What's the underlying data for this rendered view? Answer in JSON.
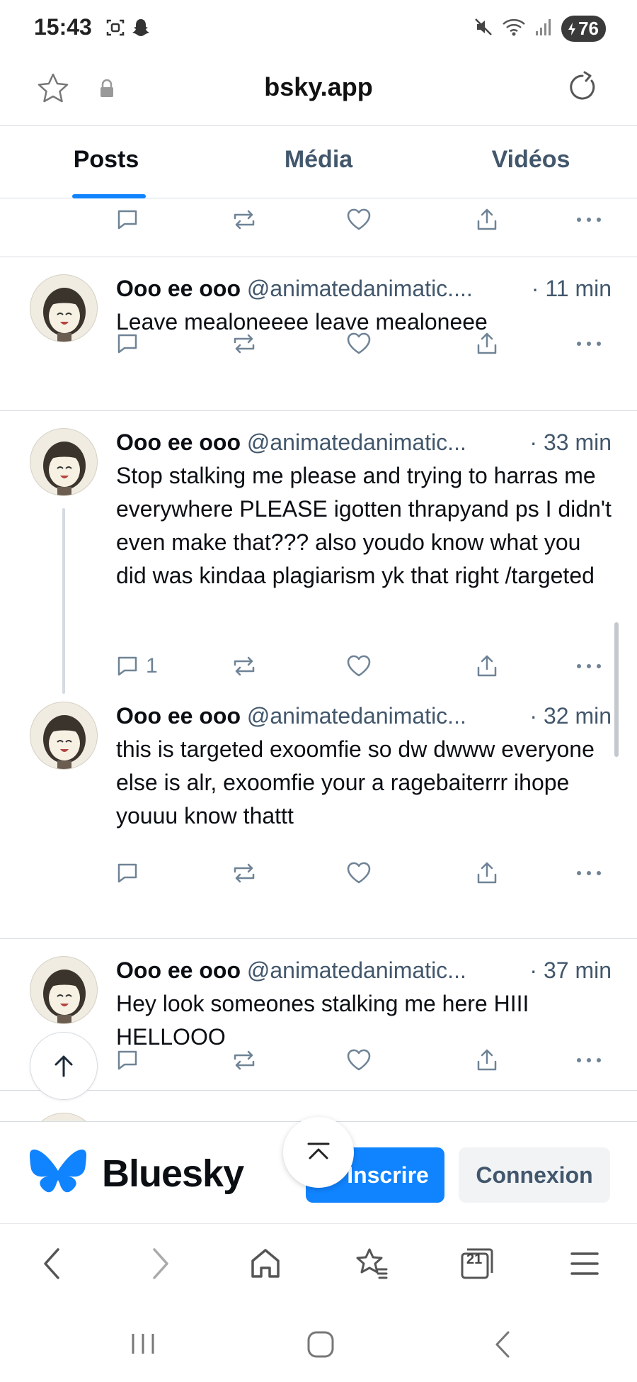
{
  "status_bar": {
    "time": "15:43",
    "battery": "76",
    "icons": [
      "screenshot-icon",
      "snapchat-icon",
      "mute-icon",
      "wifi-icon",
      "signal-icon",
      "battery-icon"
    ]
  },
  "browser": {
    "url": "bsky.app"
  },
  "tabs": [
    {
      "label": "Posts",
      "active": true
    },
    {
      "label": "Média",
      "active": false
    },
    {
      "label": "Vidéos",
      "active": false
    }
  ],
  "posts": [
    {
      "name": "Ooo ee ooo",
      "handle": "@animatedanimatic....",
      "time": "· 11 min",
      "text": "Leave mealoneeee leave mealoneee",
      "replies": ""
    },
    {
      "name": "Ooo ee ooo",
      "handle": "@animatedanimatic...",
      "time": "· 33 min",
      "text": "Stop stalking me please and trying to harras me everywhere PLEASE igotten thrapyand ps I didn't even make that??? also youdo know what you did was kindaa plagiarism yk that right /targeted",
      "replies": "1"
    },
    {
      "name": "Ooo ee ooo",
      "handle": "@animatedanimatic...",
      "time": "· 32 min",
      "text": "this is targeted exoomfie so dw dwww everyone else is alr, exoomfie your a ragebaiterrr ihope youuu know thattt",
      "replies": ""
    },
    {
      "name": "Ooo ee ooo",
      "handle": "@animatedanimatic...",
      "time": "· 37 min",
      "text": "Hey look someones stalking me here HIII HELLOOO",
      "replies": ""
    }
  ],
  "banner": {
    "brand": "Bluesky",
    "signup": "Inscrire",
    "login": "Connexion"
  },
  "toolbar": {
    "tab_count": "21"
  },
  "colors": {
    "accent": "#1083fe",
    "muted": "#42576c",
    "icon": "#6f8396",
    "divider": "#d7dce2"
  }
}
